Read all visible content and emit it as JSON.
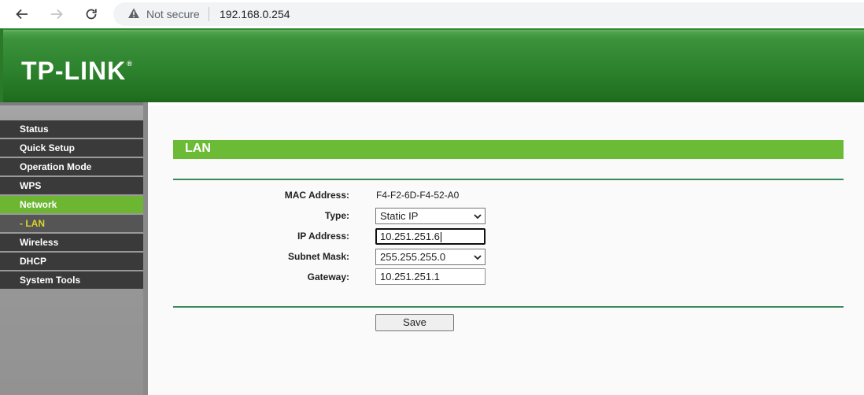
{
  "browser": {
    "security_label": "Not secure",
    "url": "192.168.0.254"
  },
  "header": {
    "logo": "TP-LINK",
    "logo_mark": "®",
    "brand_color": "#2c812c"
  },
  "sidebar": {
    "items": [
      {
        "label": "Status"
      },
      {
        "label": "Quick Setup"
      },
      {
        "label": "Operation Mode"
      },
      {
        "label": "WPS"
      },
      {
        "label": "Network"
      },
      {
        "label": "- LAN"
      },
      {
        "label": "Wireless"
      },
      {
        "label": "DHCP"
      },
      {
        "label": "System Tools"
      }
    ],
    "active_label": "Network",
    "active_color": "#6cb631"
  },
  "main": {
    "title": "LAN",
    "fields": {
      "mac_label": "MAC Address:",
      "mac_value": "F4-F2-6D-F4-52-A0",
      "type_label": "Type:",
      "type_value": "Static IP",
      "ip_label": "IP Address:",
      "ip_value": "10.251.251.6",
      "mask_label": "Subnet Mask:",
      "mask_value": "255.255.255.0",
      "gateway_label": "Gateway:",
      "gateway_value": "10.251.251.1"
    },
    "save_label": "Save"
  }
}
